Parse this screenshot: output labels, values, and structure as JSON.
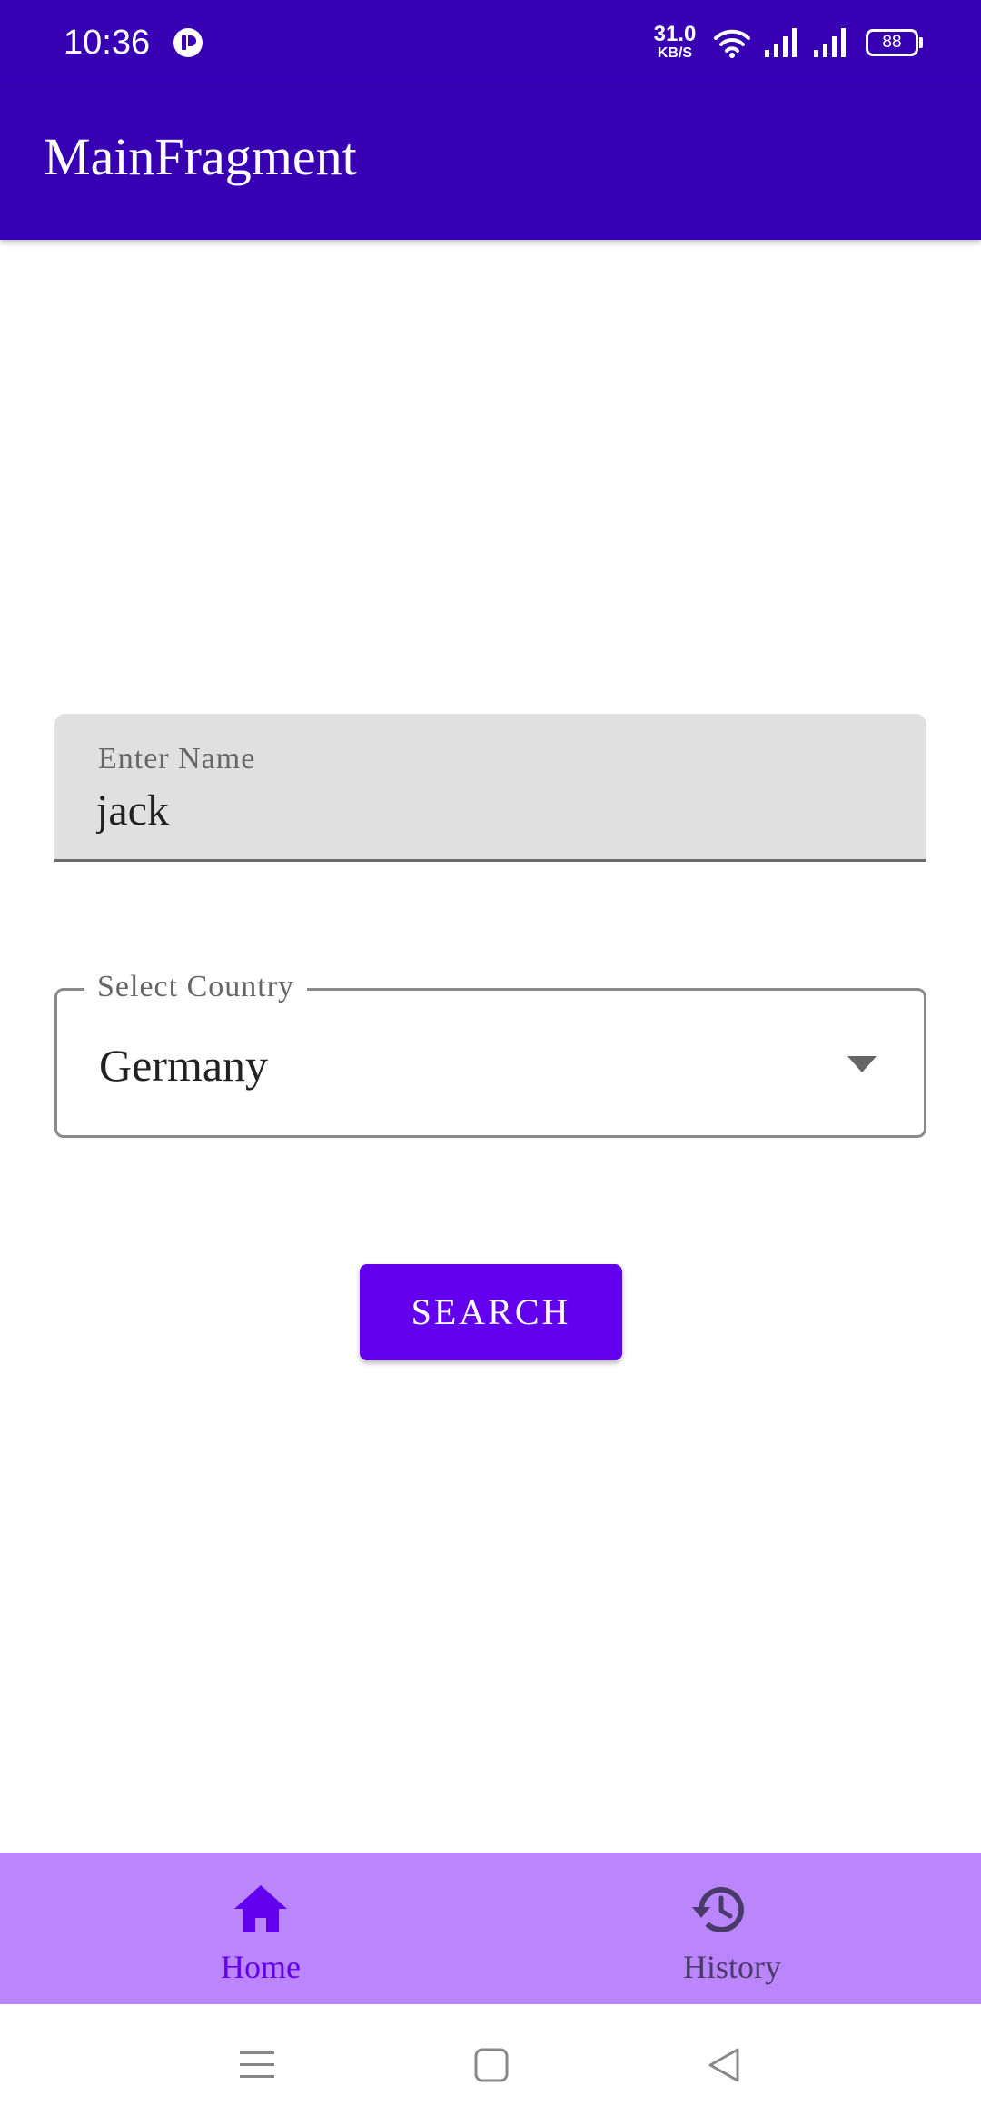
{
  "status_bar": {
    "time": "10:36",
    "net_speed_value": "31.0",
    "net_speed_unit": "KB/S",
    "battery_level": "88",
    "icons": [
      "app-notification-icon",
      "wifi-icon",
      "signal-icon",
      "signal-icon",
      "battery-icon"
    ]
  },
  "app_bar": {
    "title": "MainFragment",
    "color": "#3700b3"
  },
  "form": {
    "name_label": "Enter Name",
    "name_value": "jack",
    "country_label": "Select Country",
    "country_value": "Germany",
    "search_label": "SEARCH",
    "accent_color": "#6200ee"
  },
  "bottom_nav": {
    "background": "#bb86fc",
    "items": [
      {
        "label": "Home",
        "icon": "home-icon",
        "selected": true
      },
      {
        "label": "History",
        "icon": "history-icon",
        "selected": false
      }
    ]
  },
  "system_nav": {
    "icons": [
      "menu-icon",
      "home-square-icon",
      "back-triangle-icon"
    ]
  }
}
